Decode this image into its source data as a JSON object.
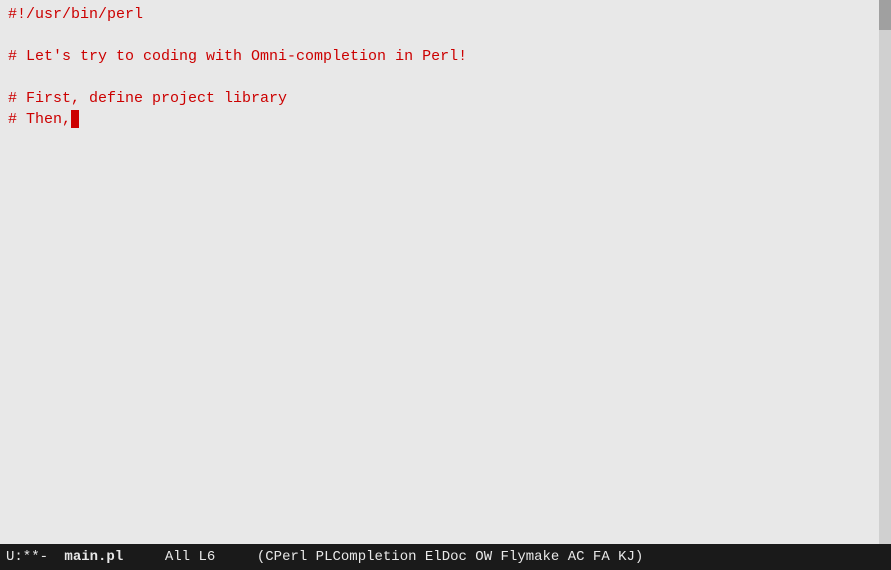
{
  "editor": {
    "background": "#e8e8e8",
    "text_color": "#cc0000"
  },
  "code": {
    "lines": [
      "#!/usr/bin/perl",
      "",
      "# Let's try to coding with Omni-completion in Perl!",
      "",
      "# First, define project library",
      "# Then,"
    ],
    "cursor_line": 5,
    "cursor_col": 9
  },
  "status_bar": {
    "mode": "U:**-",
    "filename": "main.pl",
    "position": "All L6",
    "plugins": "(CPerl PLCompletion ElDoc OW Flymake AC FA KJ)"
  }
}
